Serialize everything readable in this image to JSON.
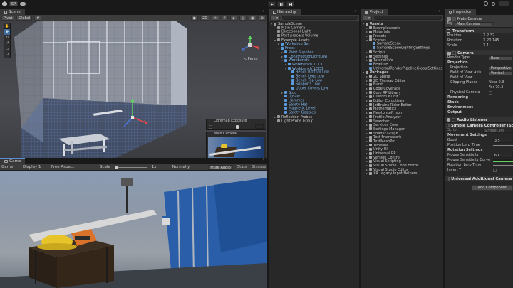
{
  "topbar": {
    "account": "SP",
    "play_icon": "play-icon",
    "pause_icon": "pause-icon",
    "step_icon": "step-icon"
  },
  "scene": {
    "tab": "Scene",
    "pivot": "Pivot",
    "global": "Global",
    "persp_label": "< Persp",
    "overlay_exposure": "Lightmap Exposure",
    "overlay_camera": "Main Camera"
  },
  "game": {
    "tab": "Game",
    "display_mode": "Game",
    "display": "Display 1",
    "aspect": "Free Aspect",
    "scale_label": "Scale",
    "scale_value": "1x",
    "normally": "Normally",
    "mute": "Mute Audio",
    "stats": "Stats",
    "gizmos": "Gizmos"
  },
  "hierarchy": {
    "tab": "Hierarchy",
    "items": [
      {
        "label": "SampleScene",
        "depth": 0,
        "blue": false,
        "fold": "▾"
      },
      {
        "label": "Main Camera",
        "depth": 1,
        "blue": false,
        "fold": ""
      },
      {
        "label": "Directional Light",
        "depth": 1,
        "blue": false,
        "fold": ""
      },
      {
        "label": "Post-process Volume",
        "depth": 1,
        "blue": false,
        "fold": ""
      },
      {
        "label": "Example Assets",
        "depth": 1,
        "blue": false,
        "fold": "▾"
      },
      {
        "label": "Workshop Set",
        "depth": 2,
        "blue": true,
        "fold": "▸"
      },
      {
        "label": "Props",
        "depth": 2,
        "blue": true,
        "fold": "▾"
      },
      {
        "label": "Paint Supplies",
        "depth": 3,
        "blue": true,
        "fold": "▸"
      },
      {
        "label": "ConstructionLightLow",
        "depth": 3,
        "blue": true,
        "fold": "▸"
      },
      {
        "label": "Workbench",
        "depth": 3,
        "blue": true,
        "fold": "▾"
      },
      {
        "label": "Workbench_LOD0",
        "depth": 4,
        "blue": true,
        "fold": "▸"
      },
      {
        "label": "Workbench_LOD1",
        "depth": 4,
        "blue": true,
        "fold": "▾"
      },
      {
        "label": "Bench Bottom Low",
        "depth": 5,
        "blue": true,
        "fold": ""
      },
      {
        "label": "Bench Legs Low",
        "depth": 5,
        "blue": true,
        "fold": ""
      },
      {
        "label": "Bench Top Low",
        "depth": 5,
        "blue": true,
        "fold": ""
      },
      {
        "label": "Supports Low",
        "depth": 5,
        "blue": true,
        "fold": ""
      },
      {
        "label": "Upper Covers Low",
        "depth": 5,
        "blue": true,
        "fold": ""
      },
      {
        "label": "Stud",
        "depth": 3,
        "blue": true,
        "fold": "▸"
      },
      {
        "label": "Jigsaw",
        "depth": 3,
        "blue": true,
        "fold": ""
      },
      {
        "label": "Hammer",
        "depth": 3,
        "blue": true,
        "fold": ""
      },
      {
        "label": "Safety Hat",
        "depth": 3,
        "blue": true,
        "fold": ""
      },
      {
        "label": "Magnetic Level",
        "depth": 3,
        "blue": true,
        "fold": ""
      },
      {
        "label": "Safety Goggles",
        "depth": 3,
        "blue": true,
        "fold": ""
      },
      {
        "label": "Reflection Probes",
        "depth": 1,
        "blue": false,
        "fold": "▸"
      },
      {
        "label": "Light Probe Group",
        "depth": 1,
        "blue": false,
        "fold": ""
      }
    ]
  },
  "project": {
    "tab": "Project",
    "items": [
      {
        "label": "Assets",
        "depth": 0,
        "fold": "▾",
        "bold": true
      },
      {
        "label": "ExampleAssets",
        "depth": 1,
        "fold": "▸"
      },
      {
        "label": "Materials",
        "depth": 1,
        "fold": "▸"
      },
      {
        "label": "Presets",
        "depth": 1,
        "fold": "▸"
      },
      {
        "label": "Scenes",
        "depth": 1,
        "fold": "▾"
      },
      {
        "label": "SampleScene",
        "depth": 2,
        "fold": ""
      },
      {
        "label": "SampleSceneLightingSettings",
        "depth": 2,
        "fold": ""
      },
      {
        "label": "Scripts",
        "depth": 1,
        "fold": "▸"
      },
      {
        "label": "Settings",
        "depth": 1,
        "fold": "▸"
      },
      {
        "label": "TutorialInfo",
        "depth": 1,
        "fold": "▸"
      },
      {
        "label": "Readme",
        "depth": 1,
        "fold": ""
      },
      {
        "label": "UniversalRenderPipelineGlobalSettings",
        "depth": 1,
        "fold": ""
      },
      {
        "label": "Packages",
        "depth": 0,
        "fold": "▾",
        "bold": true
      },
      {
        "label": "2D Sprite",
        "depth": 1,
        "fold": "▸"
      },
      {
        "label": "2D Tilemap Editor",
        "depth": 1,
        "fold": "▸"
      },
      {
        "label": "Burst",
        "depth": 1,
        "fold": "▸"
      },
      {
        "label": "Code Coverage",
        "depth": 1,
        "fold": "▸"
      },
      {
        "label": "Core RP Library",
        "depth": 1,
        "fold": "▸"
      },
      {
        "label": "Custom NUnit",
        "depth": 1,
        "fold": "▸"
      },
      {
        "label": "Editor Coroutines",
        "depth": 1,
        "fold": "▸"
      },
      {
        "label": "JetBrains Rider Editor",
        "depth": 1,
        "fold": "▸"
      },
      {
        "label": "Mathematics",
        "depth": 1,
        "fold": "▸"
      },
      {
        "label": "Newtonsoft Json",
        "depth": 1,
        "fold": "▸"
      },
      {
        "label": "Profile Analyzer",
        "depth": 1,
        "fold": "▸"
      },
      {
        "label": "Searcher",
        "depth": 1,
        "fold": "▸"
      },
      {
        "label": "Services Core",
        "depth": 1,
        "fold": "▸"
      },
      {
        "label": "Settings Manager",
        "depth": 1,
        "fold": "▸"
      },
      {
        "label": "Shader Graph",
        "depth": 1,
        "fold": "▸"
      },
      {
        "label": "Test Framework",
        "depth": 1,
        "fold": "▸"
      },
      {
        "label": "TextMeshPro",
        "depth": 1,
        "fold": "▸"
      },
      {
        "label": "Timeline",
        "depth": 1,
        "fold": "▸"
      },
      {
        "label": "Unity UI",
        "depth": 1,
        "fold": "▸"
      },
      {
        "label": "Universal RP",
        "depth": 1,
        "fold": "▸"
      },
      {
        "label": "Version Control",
        "depth": 1,
        "fold": "▸"
      },
      {
        "label": "Visual Scripting",
        "depth": 1,
        "fold": "▸"
      },
      {
        "label": "Visual Studio Code Editor",
        "depth": 1,
        "fold": "▸"
      },
      {
        "label": "Visual Studio Editor",
        "depth": 1,
        "fold": "▸"
      },
      {
        "label": "XR Legacy Input Helpers",
        "depth": 1,
        "fold": "▸"
      }
    ]
  },
  "inspector": {
    "tab": "Inspector",
    "object_name": "Main Camera",
    "tag_label": "Tag",
    "tag_value": "Main Camera",
    "transform": {
      "title": "Transform",
      "position_label": "Position",
      "position_x": "X 2.32",
      "rotation_label": "Rotation",
      "rotation_x": "X 20.145",
      "scale_label": "Scale",
      "scale_x": "X 1"
    },
    "camera": {
      "title": "Camera",
      "render_type_label": "Render Type",
      "render_type_value": "Base",
      "projection_section": "Projection",
      "projection_label": "Projection",
      "projection_value": "Perspective",
      "fov_axis_label": "Field of View Axis",
      "fov_axis_value": "Vertical",
      "fov_label": "Field of View",
      "clipping_label": "Clipping Planes",
      "clip_near": "Near 0.3",
      "clip_far": "Far 70.3",
      "physical_label": "Physical Camera",
      "rendering": "Rendering",
      "stack": "Stack",
      "environment": "Environment",
      "output": "Output"
    },
    "audio_listener": "Audio Listener",
    "controller": {
      "title": "Simple Camera Controller (Script)",
      "script_label": "Script",
      "script_value": "SimpleCam",
      "movement_section": "Movement Settings",
      "boost_label": "Boost",
      "boost_value": "3.5",
      "pos_lerp_label": "Position Lerp Time",
      "rotation_section": "Rotation Settings",
      "mouse_sens_label": "Mouse Sensitivity",
      "mouse_sens_value": "60",
      "mouse_curve_label": "Mouse Sensitivity Curve",
      "rot_lerp_label": "Rotation Lerp Time",
      "invert_label": "Invert Y"
    },
    "urp_camera": "Universal Additional Camera Data",
    "add_component": "Add Component"
  }
}
